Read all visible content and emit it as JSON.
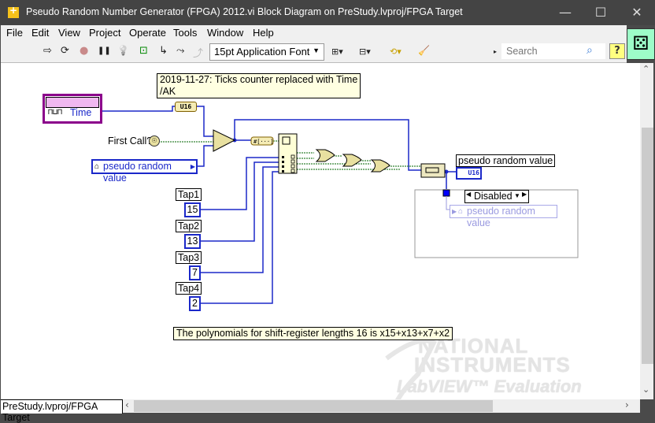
{
  "window": {
    "title": "Pseudo Random Number Generator (FPGA) 2012.vi Block Diagram on PreStudy.lvproj/FPGA Target",
    "controls": {
      "minimize": "—",
      "maximize": "☐",
      "close": "✕"
    }
  },
  "menu": [
    "File",
    "Edit",
    "View",
    "Project",
    "Operate",
    "Tools",
    "Window",
    "Help"
  ],
  "toolbar": {
    "run": "⇨",
    "run_continuously": "⟳",
    "abort": "●",
    "pause": "❚❚",
    "highlight_execution": "💡",
    "retain_wire_values": "⊡",
    "step_into": "↳",
    "step_over": "⤳",
    "step_out": "⤴",
    "font_select": "15pt Application Font",
    "align": "⊞▾",
    "distribute": "⊟▾",
    "reorder": "⟲▾",
    "cleanup": "🧹",
    "search_placeholder": "Search",
    "help": "?"
  },
  "diagram": {
    "time_node": {
      "label": "Time",
      "icon": "pulse-train-icon"
    },
    "first_call_label": "First Call?",
    "shift_register_control": "pseudo random value",
    "u16_convert": "U16",
    "number_to_bool_array": "#[···]",
    "comment_top": "2019-11-27: Ticks counter replaced with Time\n/AK",
    "comment_bottom": "The polynomials for shift-register lengths 16 is x15+x13+x7+x2",
    "taps": [
      {
        "label": "Tap1",
        "value": "15"
      },
      {
        "label": "Tap2",
        "value": "13"
      },
      {
        "label": "Tap3",
        "value": "7"
      },
      {
        "label": "Tap4",
        "value": "2"
      }
    ],
    "indicator": {
      "label": "pseudo random value",
      "type": "U16"
    },
    "disable_structure": {
      "case": "Disabled",
      "local_variable": "pseudo random value"
    }
  },
  "watermark": {
    "line1": "NATIONAL",
    "line2": "INSTRUMENTS",
    "line3": "LabVIEW™ Evaluation Software"
  },
  "status": {
    "context": "PreStudy.lvproj/FPGA Target"
  },
  "colors": {
    "wire_numeric": "#1b28c9",
    "wire_boolean": "#006400",
    "comment_bg": "#ffffe1",
    "time_node_border": "#8b008b"
  }
}
